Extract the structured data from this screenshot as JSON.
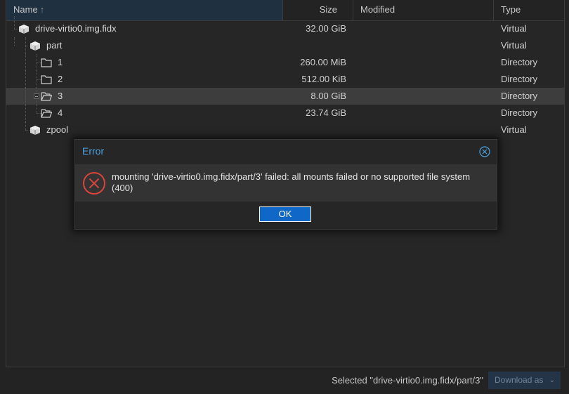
{
  "columns": {
    "name": "Name",
    "size": "Size",
    "modified": "Modified",
    "type": "Type"
  },
  "rows": [
    {
      "name": "drive-virtio0.img.fidx",
      "size": "32.00 GiB",
      "type": "Virtual",
      "icon": "package-icon"
    },
    {
      "name": "part",
      "size": "",
      "type": "Virtual",
      "icon": "package-icon"
    },
    {
      "name": "1",
      "size": "260.00 MiB",
      "type": "Directory",
      "icon": "folder-icon"
    },
    {
      "name": "2",
      "size": "512.00 KiB",
      "type": "Directory",
      "icon": "folder-icon"
    },
    {
      "name": "3",
      "size": "8.00 GiB",
      "type": "Directory",
      "icon": "folder-open-icon",
      "selected": true
    },
    {
      "name": "4",
      "size": "23.74 GiB",
      "type": "Directory",
      "icon": "folder-open-icon"
    },
    {
      "name": "zpool",
      "size": "",
      "type": "Virtual",
      "icon": "package-icon"
    }
  ],
  "dialog": {
    "title": "Error",
    "message": "mounting 'drive-virtio0.img.fidx/part/3' failed: all mounts failed or no supported file system (400)",
    "ok_label": "OK"
  },
  "footer": {
    "status": "Selected \"drive-virtio0.img.fidx/part/3\"",
    "download_label": "Download as"
  },
  "colors": {
    "accent": "#4ea3e0",
    "error": "#d9453c",
    "button": "#0f68c7"
  }
}
